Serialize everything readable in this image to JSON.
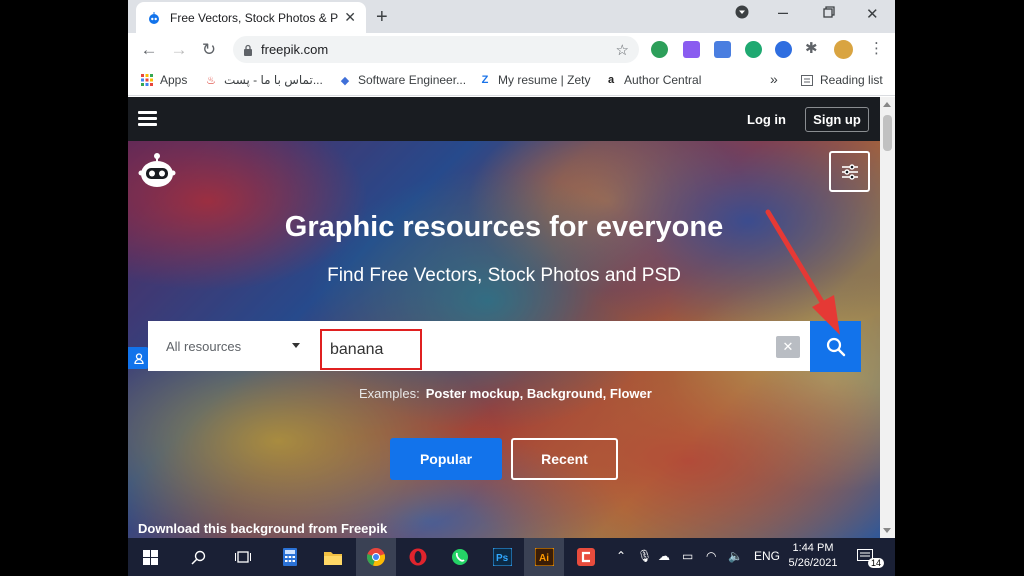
{
  "browser": {
    "tab_title": "Free Vectors, Stock Photos & PSD",
    "tab_close": "✕",
    "new_tab": "+",
    "url": "freepik.com",
    "bookmarks": [
      {
        "label": "Apps"
      },
      {
        "label": "تماس با ما - پست..."
      },
      {
        "label": "Software Engineer..."
      },
      {
        "label": "My resume | Zety"
      },
      {
        "label": "Author Central"
      }
    ],
    "bookmarks_overflow": "»",
    "reading_list": "Reading list"
  },
  "site": {
    "nav": {
      "login": "Log in",
      "signup": "Sign up"
    },
    "headline": "Graphic resources for everyone",
    "subhead": "Find Free Vectors, Stock Photos and PSD",
    "search": {
      "resource_type": "All resources",
      "query": "banana",
      "clear": "✕"
    },
    "examples_label": "Examples:",
    "examples": "Poster mockup, Background, Flower",
    "buttons": {
      "popular": "Popular",
      "recent": "Recent"
    },
    "credit": "Download this background from Freepik"
  },
  "taskbar": {
    "language": "ENG",
    "time": "1:44 PM",
    "date": "5/26/2021",
    "notifications": "14"
  },
  "colors": {
    "accent": "#1273eb",
    "highlight": "#e02020",
    "nav_bg": "#191c21",
    "taskbar_bg": "#1a2035"
  }
}
